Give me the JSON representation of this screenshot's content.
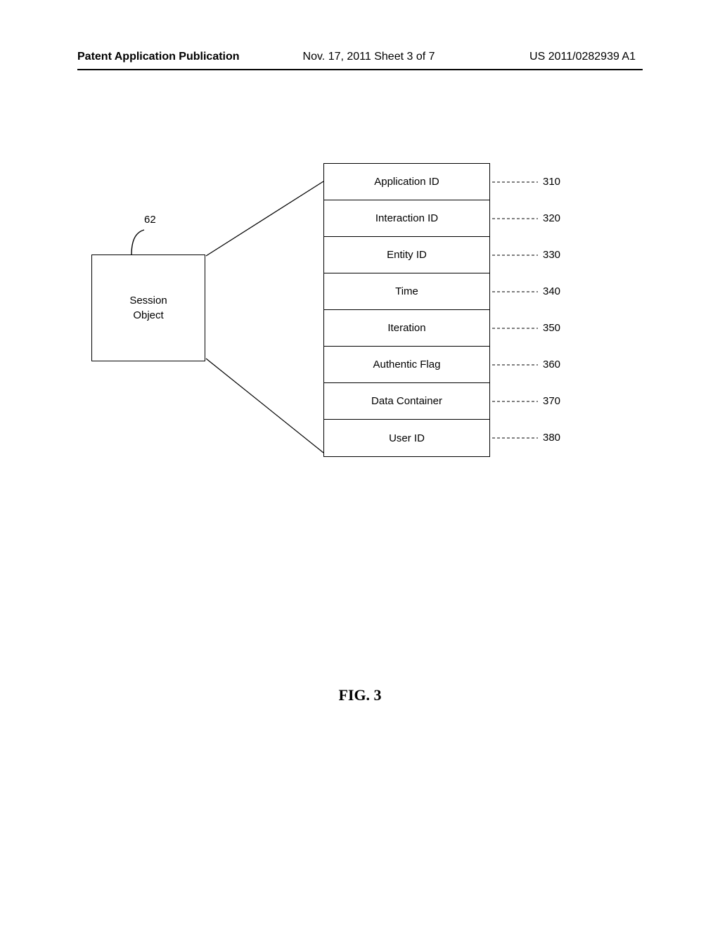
{
  "header": {
    "left": "Patent Application Publication",
    "center": "Nov. 17, 2011  Sheet 3 of 7",
    "right": "US 2011/0282939 A1"
  },
  "session_object": {
    "ref": "62",
    "label_line1": "Session",
    "label_line2": "Object"
  },
  "fields": [
    {
      "label": "Application ID",
      "ref": "310"
    },
    {
      "label": "Interaction ID",
      "ref": "320"
    },
    {
      "label": "Entity ID",
      "ref": "330"
    },
    {
      "label": "Time",
      "ref": "340"
    },
    {
      "label": "Iteration",
      "ref": "350"
    },
    {
      "label": "Authentic Flag",
      "ref": "360"
    },
    {
      "label": "Data Container",
      "ref": "370"
    },
    {
      "label": "User ID",
      "ref": "380"
    }
  ],
  "figure_caption": "FIG. 3"
}
